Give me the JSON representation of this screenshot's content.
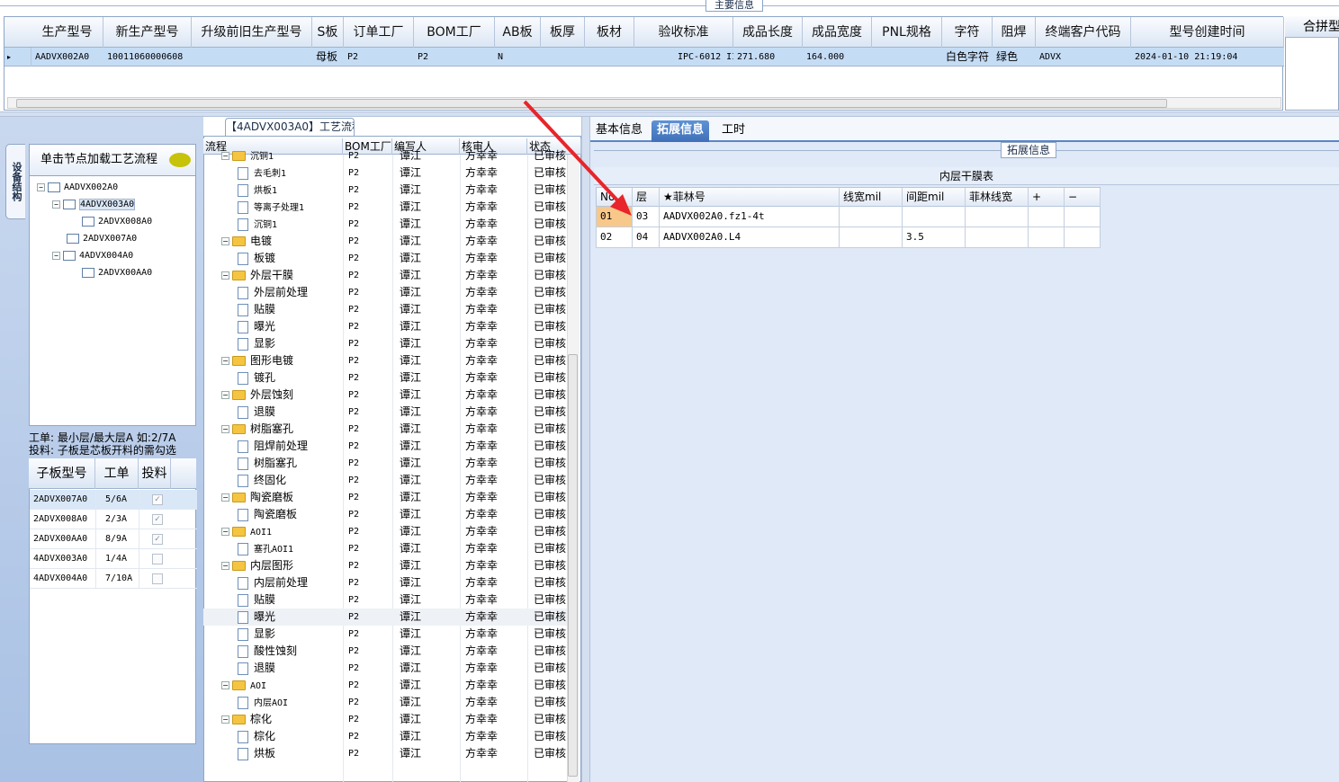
{
  "top": {
    "section_title": "主要信息",
    "columns": [
      "生产型号",
      "新生产型号",
      "升级前旧生产型号",
      "S板",
      "订单工厂",
      "BOM工厂",
      "AB板",
      "板厚",
      "板材",
      "验收标准",
      "成品长度",
      "成品宽度",
      "PNL规格",
      "字符",
      "阻焊",
      "终端客户代码",
      "型号创建时间"
    ],
    "row": {
      "indicator": "▸",
      "prod_model": "AADVX002A0",
      "new_model": "10011060000608",
      "old_model": "",
      "s_board": "母板",
      "order_factory": "P2",
      "bom_factory": "P2",
      "ab_board": "N",
      "thickness": "",
      "material": "",
      "standard": "IPC-6012 II级",
      "length": "271.680",
      "width": "164.000",
      "pnl": "",
      "char": "白色字符",
      "mask": "绿色",
      "customer": "ADVX",
      "created": "2024-01-10 21:19:04"
    },
    "right_stub_header": "合拼型"
  },
  "left": {
    "vtab": "设备结构",
    "tree_header": "单击节点加载工艺流程",
    "tree": [
      {
        "label": "AADVX002A0",
        "level": 0,
        "toggle": "−"
      },
      {
        "label": "4ADVX003A0",
        "level": 1,
        "toggle": "−",
        "selected": true
      },
      {
        "label": "2ADVX008A0",
        "level": 2,
        "toggle": ""
      },
      {
        "label": "2ADVX007A0",
        "level": 1,
        "toggle": ""
      },
      {
        "label": "4ADVX004A0",
        "level": 1,
        "toggle": "−"
      },
      {
        "label": "2ADVX00AA0",
        "level": 2,
        "toggle": ""
      }
    ],
    "note_line1": "工单: 最小层/最大层A 如:2/7A",
    "note_line2": "投料: 子板是芯板开料的需勾选",
    "sub_columns": [
      "子板型号",
      "工单",
      "投料"
    ],
    "sub_rows": [
      {
        "model": "2ADVX007A0",
        "order": "5/6A",
        "feed": true
      },
      {
        "model": "2ADVX008A0",
        "order": "2/3A",
        "feed": true
      },
      {
        "model": "2ADVX00AA0",
        "order": "8/9A",
        "feed": true
      },
      {
        "model": "4ADVX003A0",
        "order": "1/4A",
        "feed": false
      },
      {
        "model": "4ADVX004A0",
        "order": "7/10A",
        "feed": false
      }
    ]
  },
  "process": {
    "title": "【4ADVX003A0】工艺流程",
    "columns": [
      "流程",
      "BOM工厂",
      "编写人",
      "核审人",
      "状态"
    ],
    "rows": [
      {
        "name": "沉铜1",
        "type": "folder",
        "factory": "P2",
        "writer": "谭江",
        "reviewer": "方幸幸",
        "status": "已审核"
      },
      {
        "name": "去毛刺1",
        "type": "step",
        "factory": "P2",
        "writer": "谭江",
        "reviewer": "方幸幸",
        "status": "已审核"
      },
      {
        "name": "烘板1",
        "type": "step",
        "factory": "P2",
        "writer": "谭江",
        "reviewer": "方幸幸",
        "status": "已审核"
      },
      {
        "name": "等离子处理1",
        "type": "step",
        "factory": "P2",
        "writer": "谭江",
        "reviewer": "方幸幸",
        "status": "已审核"
      },
      {
        "name": "沉铜1",
        "type": "step",
        "factory": "P2",
        "writer": "谭江",
        "reviewer": "方幸幸",
        "status": "已审核"
      },
      {
        "name": "电镀",
        "type": "folder",
        "factory": "P2",
        "writer": "谭江",
        "reviewer": "方幸幸",
        "status": "已审核"
      },
      {
        "name": "板镀",
        "type": "step",
        "factory": "P2",
        "writer": "谭江",
        "reviewer": "方幸幸",
        "status": "已审核"
      },
      {
        "name": "外层干膜",
        "type": "folder",
        "factory": "P2",
        "writer": "谭江",
        "reviewer": "方幸幸",
        "status": "已审核"
      },
      {
        "name": "外层前处理",
        "type": "step",
        "factory": "P2",
        "writer": "谭江",
        "reviewer": "方幸幸",
        "status": "已审核"
      },
      {
        "name": "贴膜",
        "type": "step",
        "factory": "P2",
        "writer": "谭江",
        "reviewer": "方幸幸",
        "status": "已审核"
      },
      {
        "name": "曝光",
        "type": "step",
        "factory": "P2",
        "writer": "谭江",
        "reviewer": "方幸幸",
        "status": "已审核"
      },
      {
        "name": "显影",
        "type": "step",
        "factory": "P2",
        "writer": "谭江",
        "reviewer": "方幸幸",
        "status": "已审核"
      },
      {
        "name": "图形电镀",
        "type": "folder",
        "factory": "P2",
        "writer": "谭江",
        "reviewer": "方幸幸",
        "status": "已审核"
      },
      {
        "name": "镀孔",
        "type": "step",
        "factory": "P2",
        "writer": "谭江",
        "reviewer": "方幸幸",
        "status": "已审核"
      },
      {
        "name": "外层蚀刻",
        "type": "folder",
        "factory": "P2",
        "writer": "谭江",
        "reviewer": "方幸幸",
        "status": "已审核"
      },
      {
        "name": "退膜",
        "type": "step",
        "factory": "P2",
        "writer": "谭江",
        "reviewer": "方幸幸",
        "status": "已审核"
      },
      {
        "name": "树脂塞孔",
        "type": "folder",
        "factory": "P2",
        "writer": "谭江",
        "reviewer": "方幸幸",
        "status": "已审核"
      },
      {
        "name": "阻焊前处理",
        "type": "step",
        "factory": "P2",
        "writer": "谭江",
        "reviewer": "方幸幸",
        "status": "已审核"
      },
      {
        "name": "树脂塞孔",
        "type": "step",
        "factory": "P2",
        "writer": "谭江",
        "reviewer": "方幸幸",
        "status": "已审核"
      },
      {
        "name": "终固化",
        "type": "step",
        "factory": "P2",
        "writer": "谭江",
        "reviewer": "方幸幸",
        "status": "已审核"
      },
      {
        "name": "陶瓷磨板",
        "type": "folder",
        "factory": "P2",
        "writer": "谭江",
        "reviewer": "方幸幸",
        "status": "已审核"
      },
      {
        "name": "陶瓷磨板",
        "type": "step",
        "factory": "P2",
        "writer": "谭江",
        "reviewer": "方幸幸",
        "status": "已审核"
      },
      {
        "name": "AOI1",
        "type": "folder",
        "factory": "P2",
        "writer": "谭江",
        "reviewer": "方幸幸",
        "status": "已审核"
      },
      {
        "name": "塞孔AOI1",
        "type": "step",
        "factory": "P2",
        "writer": "谭江",
        "reviewer": "方幸幸",
        "status": "已审核"
      },
      {
        "name": "内层图形",
        "type": "folder",
        "factory": "P2",
        "writer": "谭江",
        "reviewer": "方幸幸",
        "status": "已审核"
      },
      {
        "name": "内层前处理",
        "type": "step",
        "factory": "P2",
        "writer": "谭江",
        "reviewer": "方幸幸",
        "status": "已审核"
      },
      {
        "name": "贴膜",
        "type": "step",
        "factory": "P2",
        "writer": "谭江",
        "reviewer": "方幸幸",
        "status": "已审核"
      },
      {
        "name": "曝光",
        "type": "step",
        "factory": "P2",
        "writer": "谭江",
        "reviewer": "方幸幸",
        "status": "已审核",
        "hl": true
      },
      {
        "name": "显影",
        "type": "step",
        "factory": "P2",
        "writer": "谭江",
        "reviewer": "方幸幸",
        "status": "已审核"
      },
      {
        "name": "酸性蚀刻",
        "type": "step",
        "factory": "P2",
        "writer": "谭江",
        "reviewer": "方幸幸",
        "status": "已审核"
      },
      {
        "name": "退膜",
        "type": "step",
        "factory": "P2",
        "writer": "谭江",
        "reviewer": "方幸幸",
        "status": "已审核"
      },
      {
        "name": "AOI",
        "type": "folder",
        "factory": "P2",
        "writer": "谭江",
        "reviewer": "方幸幸",
        "status": "已审核"
      },
      {
        "name": "内层AOI",
        "type": "step",
        "factory": "P2",
        "writer": "谭江",
        "reviewer": "方幸幸",
        "status": "已审核"
      },
      {
        "name": "棕化",
        "type": "folder",
        "factory": "P2",
        "writer": "谭江",
        "reviewer": "方幸幸",
        "status": "已审核"
      },
      {
        "name": "棕化",
        "type": "step",
        "factory": "P2",
        "writer": "谭江",
        "reviewer": "方幸幸",
        "status": "已审核"
      },
      {
        "name": "烘板",
        "type": "step",
        "factory": "P2",
        "writer": "谭江",
        "reviewer": "方幸幸",
        "status": "已审核"
      }
    ]
  },
  "right": {
    "tabs": [
      "基本信息",
      "拓展信息",
      "工时"
    ],
    "active_tab": "拓展信息",
    "ext_label": "拓展信息",
    "lam_title": "内层干膜表",
    "lam_columns": [
      "No",
      "层",
      "★菲林号",
      "线宽mil",
      "间距mil",
      "菲林线宽",
      "+",
      "−"
    ],
    "lam_rows": [
      {
        "no": "01",
        "layer": "03",
        "film": "AADVX002A0.fz1-4t",
        "lw": "",
        "sp": "",
        "flw": ""
      },
      {
        "no": "02",
        "layer": "04",
        "film": "AADVX002A0.L4",
        "lw": "",
        "sp": "3.5",
        "flw": ""
      }
    ],
    "accent_color": "#e8252a"
  }
}
